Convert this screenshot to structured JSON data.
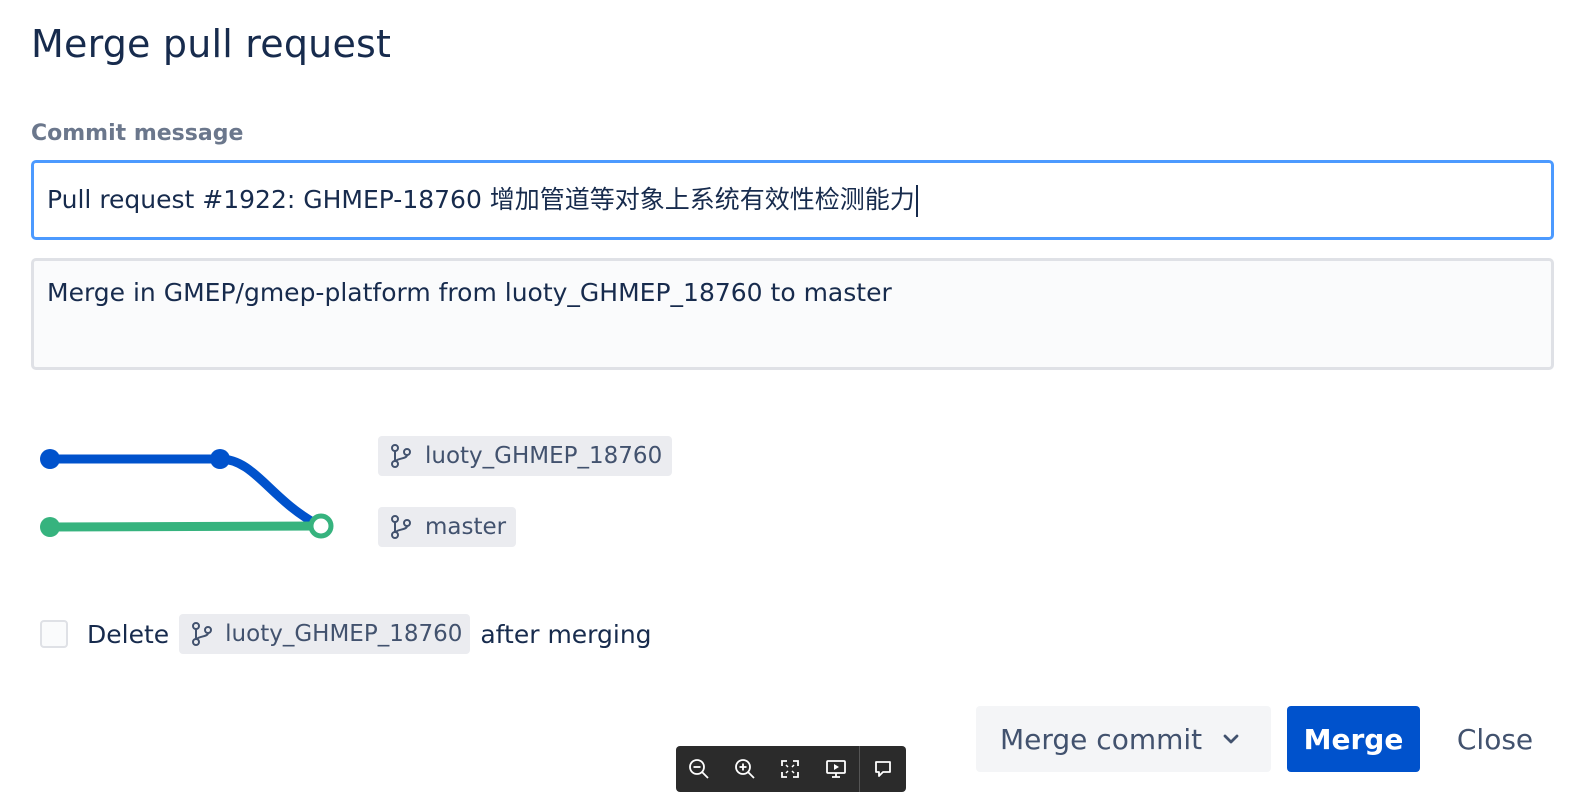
{
  "dialog": {
    "title": "Merge pull request",
    "commit_label": "Commit message",
    "subject_value": "Pull request #1922: GHMEP-18760 增加管道等对象上系统有效性检测能力",
    "body_value": "Merge in GMEP/gmep-platform from luoty_GHMEP_18760 to master"
  },
  "graph": {
    "source_branch": "luoty_GHMEP_18760",
    "target_branch": "master",
    "colors": {
      "source": "#0052cc",
      "target": "#36b37e"
    }
  },
  "delete_option": {
    "prefix": "Delete",
    "branch": "luoty_GHMEP_18760",
    "suffix": "after merging",
    "checked": false
  },
  "image_toolbar": {
    "icons": [
      "zoom-out-icon",
      "zoom-in-icon",
      "fullscreen-icon",
      "present-icon",
      "comment-icon"
    ]
  },
  "actions": {
    "strategy_label": "Merge commit",
    "merge_label": "Merge",
    "close_label": "Close"
  }
}
